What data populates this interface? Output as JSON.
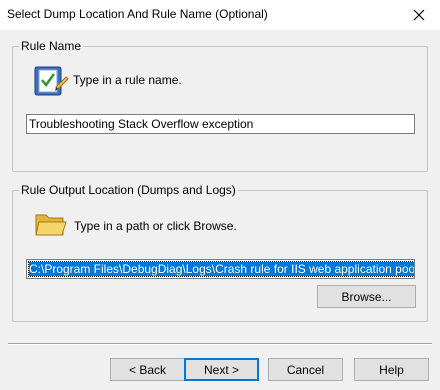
{
  "window": {
    "title": "Select Dump Location And Rule Name (Optional)"
  },
  "rule_name_group": {
    "legend": "Rule Name",
    "prompt": "Type in a rule name.",
    "value": "Troubleshooting Stack Overflow exception",
    "icon": "checklist-pencil-icon"
  },
  "output_group": {
    "legend": "Rule Output Location (Dumps and Logs)",
    "prompt": "Type in a path or click Browse.",
    "value": "C:\\Program Files\\DebugDiag\\Logs\\Crash rule for IIS web application pool - TestP",
    "browse_label": "Browse...",
    "icon": "folder-icon"
  },
  "buttons": {
    "back": "< Back",
    "next": "Next >",
    "cancel": "Cancel",
    "help": "Help"
  },
  "colors": {
    "selection": "#0078d7",
    "window_bg": "#f0f0f0"
  }
}
